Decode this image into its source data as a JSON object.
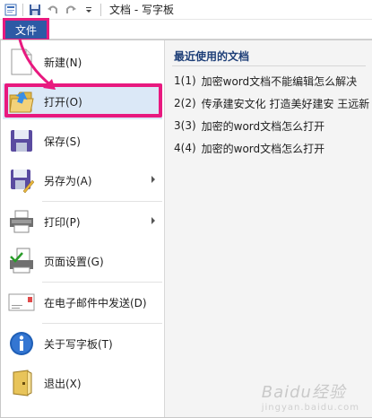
{
  "window": {
    "title": "文档 - 写字板"
  },
  "ribbon": {
    "file_tab": "文件"
  },
  "menu": {
    "items": [
      {
        "label": "新建(N)"
      },
      {
        "label": "打开(O)"
      },
      {
        "label": "保存(S)"
      },
      {
        "label": "另存为(A)"
      },
      {
        "label": "打印(P)"
      },
      {
        "label": "页面设置(G)"
      },
      {
        "label": "在电子邮件中发送(D)"
      },
      {
        "label": "关于写字板(T)"
      },
      {
        "label": "退出(X)"
      }
    ]
  },
  "recent": {
    "title": "最近使用的文档",
    "items": [
      {
        "num": "1(1)",
        "name": "加密word文档不能编辑怎么解决"
      },
      {
        "num": "2(2)",
        "name": "传承建安文化 打造美好建安 王远新"
      },
      {
        "num": "3(3)",
        "name": "加密的word文档怎么打开"
      },
      {
        "num": "4(4)",
        "name": "加密的word文档怎么打开"
      }
    ]
  },
  "watermark": {
    "text": "Baidu经验",
    "sub": "jingyan.baidu.com"
  },
  "colors": {
    "file_tab": "#2d5aa5",
    "highlight": "#e8197f",
    "hover": "#dbe8f7"
  }
}
